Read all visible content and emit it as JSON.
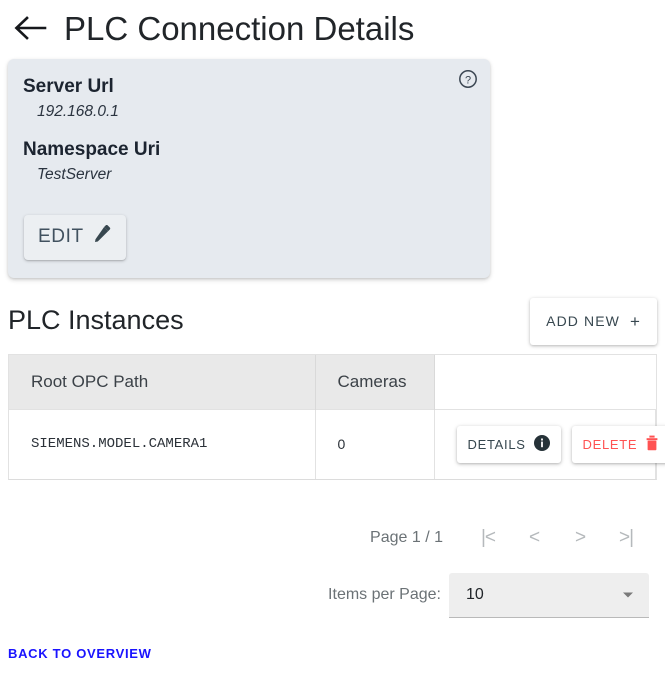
{
  "header": {
    "back_icon": "arrow-left-icon",
    "title": "PLC Connection Details"
  },
  "connection_card": {
    "help_icon": "help-circle-icon",
    "fields": [
      {
        "label": "Server Url",
        "value": "192.168.0.1"
      },
      {
        "label": "Namespace Uri",
        "value": "TestServer"
      }
    ],
    "edit_label": "EDIT",
    "edit_icon": "pencil-icon"
  },
  "instances": {
    "title": "PLC Instances",
    "add_new_label": "ADD NEW",
    "add_new_icon": "plus-icon",
    "columns": [
      "Root OPC Path",
      "Cameras",
      ""
    ],
    "rows": [
      {
        "path": "SIEMENS.MODEL.CAMERA1",
        "cameras": "0",
        "details_label": "DETAILS",
        "details_icon": "info-circle-icon",
        "delete_label": "DELETE",
        "delete_icon": "trash-icon"
      }
    ]
  },
  "paginator": {
    "page_label": "Page 1 / 1",
    "first_label": "|<",
    "prev_label": "<",
    "next_label": ">",
    "last_label": ">|",
    "items_per_page_label": "Items per Page:",
    "items_per_page_value": "10",
    "chevron_icon": "chevron-down-icon"
  },
  "footer": {
    "back_to_overview": "BACK TO OVERVIEW"
  },
  "colors": {
    "card_bg": "#E6EAEF",
    "delete_red": "#FF5252",
    "link_blue": "#1A13FF",
    "table_header_bg": "#E9E9E9"
  }
}
